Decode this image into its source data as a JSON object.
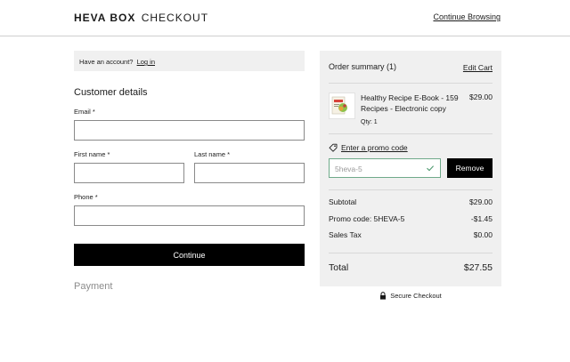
{
  "header": {
    "brand_name": "HEVA BOX",
    "brand_sub": "CHECKOUT",
    "continue_browsing": "Continue Browsing"
  },
  "account": {
    "prompt": "Have an account?",
    "login": "Log in"
  },
  "customer": {
    "title": "Customer details",
    "email_label": "Email *",
    "email_value": "",
    "first_name_label": "First name *",
    "first_name_value": "",
    "last_name_label": "Last name *",
    "last_name_value": "",
    "phone_label": "Phone *",
    "phone_value": "",
    "continue_label": "Continue"
  },
  "payment": {
    "title": "Payment"
  },
  "summary": {
    "title": "Order summary (1)",
    "edit_cart": "Edit Cart",
    "item": {
      "name": "Healthy Recipe E-Book - 159 Recipes - Electronic copy",
      "qty": "Qty: 1",
      "price": "$29.00"
    },
    "promo_link": "Enter a promo code",
    "promo_placeholder": "5heva-5",
    "remove_label": "Remove",
    "subtotal_label": "Subtotal",
    "subtotal_value": "$29.00",
    "promo_label": "Promo code: 5HEVA-5",
    "promo_value": "-$1.45",
    "tax_label": "Sales Tax",
    "tax_value": "$0.00",
    "total_label": "Total",
    "total_value": "$27.55"
  },
  "secure": {
    "label": "Secure Checkout"
  },
  "colors": {
    "accent": "#000000",
    "panel": "#f0f0f0",
    "promo_border": "#6faa8a",
    "muted": "#8c8c8c"
  }
}
